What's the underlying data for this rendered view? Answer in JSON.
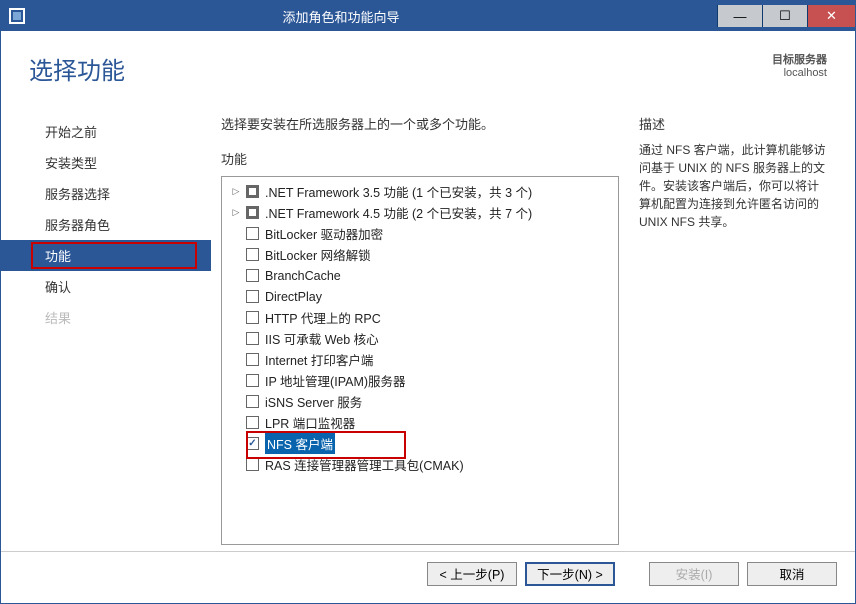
{
  "window": {
    "title": "添加角色和功能向导"
  },
  "header": {
    "page_title": "选择功能",
    "target_label": "目标服务器",
    "target_value": "localhost"
  },
  "sidebar": {
    "items": [
      {
        "label": "开始之前",
        "state": "enabled"
      },
      {
        "label": "安装类型",
        "state": "enabled"
      },
      {
        "label": "服务器选择",
        "state": "enabled"
      },
      {
        "label": "服务器角色",
        "state": "enabled"
      },
      {
        "label": "功能",
        "state": "active"
      },
      {
        "label": "确认",
        "state": "enabled"
      },
      {
        "label": "结果",
        "state": "disabled"
      }
    ]
  },
  "main": {
    "prompt": "选择要安装在所选服务器上的一个或多个功能。",
    "features_header": "功能",
    "description_header": "描述",
    "description_text": "通过 NFS 客户端，此计算机能够访问基于 UNIX 的 NFS 服务器上的文件。安装该客户端后，你可以将计算机配置为连接到允许匿名访问的 UNIX NFS 共享。",
    "features": [
      {
        "expander": "▷",
        "check": "tri",
        "label": ".NET Framework 3.5 功能 (1 个已安装，共 3 个)"
      },
      {
        "expander": "▷",
        "check": "tri",
        "label": ".NET Framework 4.5 功能 (2 个已安装，共 7 个)"
      },
      {
        "expander": "",
        "check": "none",
        "label": "BitLocker 驱动器加密"
      },
      {
        "expander": "",
        "check": "none",
        "label": "BitLocker 网络解锁"
      },
      {
        "expander": "",
        "check": "none",
        "label": "BranchCache"
      },
      {
        "expander": "",
        "check": "none",
        "label": "DirectPlay"
      },
      {
        "expander": "",
        "check": "none",
        "label": "HTTP 代理上的 RPC"
      },
      {
        "expander": "",
        "check": "none",
        "label": "IIS 可承载 Web 核心"
      },
      {
        "expander": "",
        "check": "none",
        "label": "Internet 打印客户端"
      },
      {
        "expander": "",
        "check": "none",
        "label": "IP 地址管理(IPAM)服务器"
      },
      {
        "expander": "",
        "check": "none",
        "label": "iSNS Server 服务"
      },
      {
        "expander": "",
        "check": "none",
        "label": "LPR 端口监视器"
      },
      {
        "expander": "",
        "check": "checked",
        "label": "NFS 客户端",
        "selected": true,
        "highlight": true
      },
      {
        "expander": "",
        "check": "none",
        "label": "RAS 连接管理器管理工具包(CMAK)"
      }
    ]
  },
  "footer": {
    "prev": "< 上一步(P)",
    "next": "下一步(N) >",
    "install": "安装(I)",
    "cancel": "取消"
  }
}
